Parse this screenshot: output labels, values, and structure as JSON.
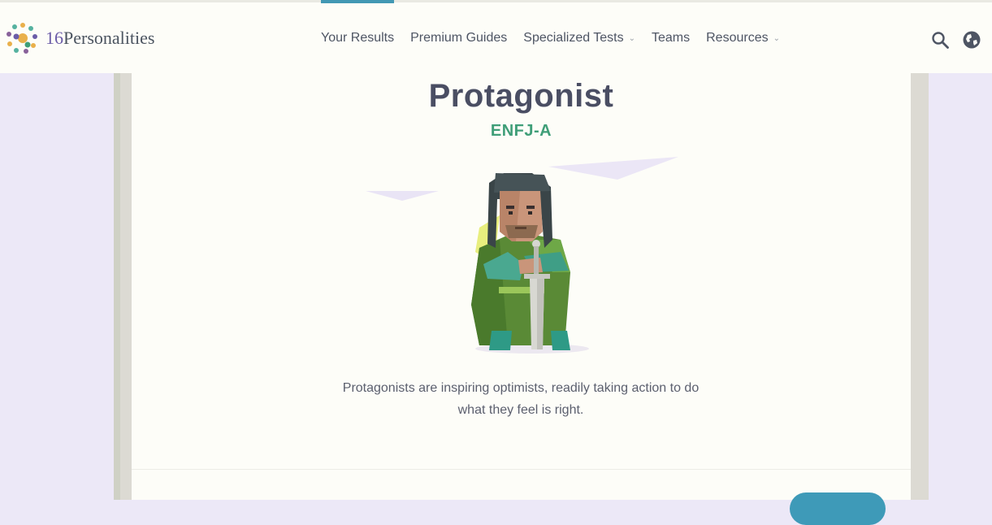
{
  "brand": {
    "name_num": "16",
    "name_text": "Personalities"
  },
  "nav": {
    "items": [
      {
        "label": "Your Results",
        "active": true,
        "dropdown": false
      },
      {
        "label": "Premium Guides",
        "active": false,
        "dropdown": false
      },
      {
        "label": "Specialized Tests",
        "active": false,
        "dropdown": true
      },
      {
        "label": "Teams",
        "active": false,
        "dropdown": false
      },
      {
        "label": "Resources",
        "active": false,
        "dropdown": true
      }
    ],
    "icons": [
      "search-icon",
      "globe-icon"
    ]
  },
  "result": {
    "title": "Protagonist",
    "code": "ENFJ-A",
    "description": "Protagonists are inspiring optimists, readily taking action to do what they feel is right."
  },
  "colors": {
    "accent": "#4298b4",
    "code_green": "#3f9e78",
    "title": "#4a4e63",
    "background": "#ece8f7"
  }
}
